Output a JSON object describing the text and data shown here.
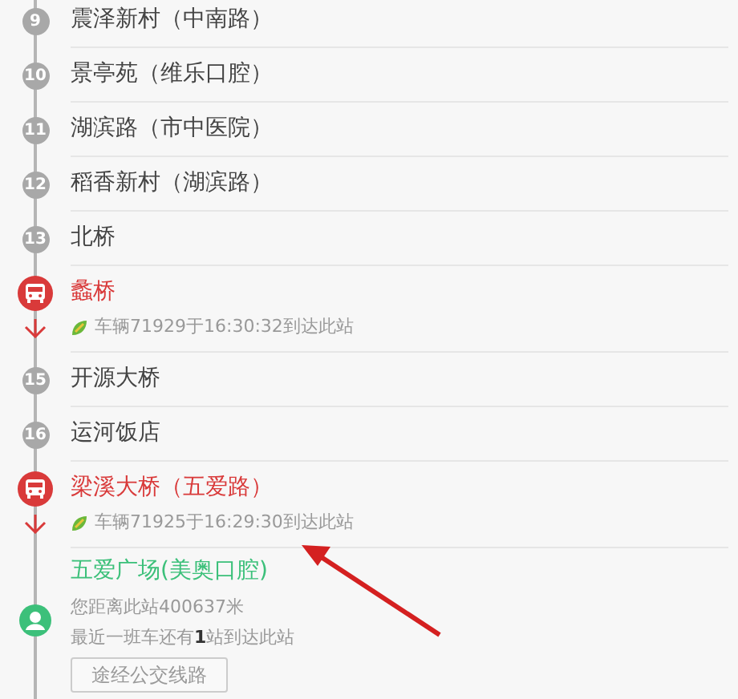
{
  "stops": [
    {
      "kind": "stop",
      "number": "9",
      "name": "震泽新村（中南路）"
    },
    {
      "kind": "stop",
      "number": "10",
      "name": "景亭苑（维乐口腔）"
    },
    {
      "kind": "stop",
      "number": "11",
      "name": "湖滨路（市中医院）"
    },
    {
      "kind": "stop",
      "number": "12",
      "name": "稻香新村（湖滨路）"
    },
    {
      "kind": "stop",
      "number": "13",
      "name": "北桥"
    },
    {
      "kind": "bus",
      "name": "蠡桥",
      "arrival": "车辆71929于16:30:32到达此站"
    },
    {
      "kind": "stop",
      "number": "15",
      "name": "开源大桥"
    },
    {
      "kind": "stop",
      "number": "16",
      "name": "运河饭店"
    },
    {
      "kind": "bus",
      "name": "梁溪大桥（五爱路）",
      "arrival": "车辆71925于16:29:30到达此站"
    },
    {
      "kind": "current",
      "name": "五爱广场(美奥口腔)",
      "distance": "您距离此站400637米",
      "next_bus": "最近一班车还有**1**站到达此站",
      "button": "途经公交线路"
    }
  ]
}
